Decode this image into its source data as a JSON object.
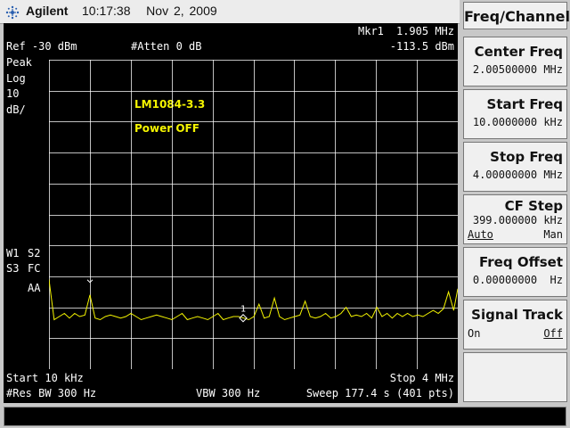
{
  "header": {
    "brand": "Agilent",
    "time": "10:17:38",
    "date": "Nov 2, 2009",
    "icon": "agilent-spark-icon"
  },
  "display": {
    "marker_label": "Mkr1",
    "marker_freq": "1.905 MHz",
    "marker_ampl": "-113.5 dBm",
    "ref_level": "Ref -30 dBm",
    "atten": "#Atten 0 dB",
    "detector": "Peak",
    "scale_type": "Log",
    "scale_value": "10",
    "scale_unit": "dB/",
    "trace_labels": [
      "W1",
      "S2",
      "S3",
      "FC",
      "AA"
    ],
    "annotation_line1": "LM1084-3.3",
    "annotation_line2": "Power OFF",
    "marker_number": "1",
    "start": "Start 10 kHz",
    "stop": "Stop 4 MHz",
    "res_bw": "#Res BW 300 Hz",
    "vbw": "VBW 300 Hz",
    "sweep": "Sweep 177.4 s (401 pts)",
    "colors": {
      "trace": "#f4f400",
      "grid": "#ffffff",
      "background": "#000000",
      "text": "#ffffff"
    }
  },
  "chart_data": {
    "type": "line",
    "xlabel": "",
    "ylabel": "",
    "xlim": [
      10,
      4000
    ],
    "ylim": [
      -130,
      -30
    ],
    "grid": true,
    "series": [
      {
        "x": [
          10,
          60,
          110,
          160,
          210,
          260,
          310,
          360,
          410,
          460,
          510,
          560,
          610,
          660,
          710,
          760,
          810,
          860,
          910,
          960,
          1010,
          1060,
          1110,
          1160,
          1210,
          1260,
          1310,
          1360,
          1410,
          1460,
          1510,
          1560,
          1610,
          1660,
          1710,
          1760,
          1810,
          1860,
          1910,
          1960,
          2010,
          2060,
          2110,
          2160,
          2210,
          2260,
          2310,
          2360,
          2410,
          2460,
          2510,
          2560,
          2610,
          2660,
          2710,
          2760,
          2810,
          2860,
          2910,
          2960,
          3010,
          3060,
          3110,
          3160,
          3210,
          3260,
          3310,
          3360,
          3410,
          3460,
          3510,
          3560,
          3610,
          3660,
          3710,
          3760,
          3810,
          3860,
          3910,
          3960,
          4000
        ],
        "values": [
          -101,
          -114,
          -113,
          -112,
          -113.5,
          -112,
          -113,
          -112.5,
          -106,
          -113.5,
          -114,
          -113,
          -112.5,
          -113,
          -113.5,
          -113,
          -112,
          -113,
          -114,
          -113.5,
          -113,
          -112.5,
          -113,
          -113.5,
          -114,
          -113,
          -112,
          -114,
          -113.5,
          -113,
          -113.5,
          -114,
          -113,
          -112,
          -114,
          -113.5,
          -113,
          -113,
          -113.5,
          -114,
          -113,
          -109,
          -113.5,
          -113,
          -107,
          -113,
          -114,
          -113.5,
          -113,
          -112.5,
          -108,
          -113,
          -113.5,
          -113,
          -112,
          -113.5,
          -113,
          -112,
          -110,
          -113,
          -112.5,
          -113,
          -112,
          -113.5,
          -110,
          -113,
          -112,
          -113.5,
          -112,
          -113,
          -112,
          -113,
          -112.5,
          -113,
          -112,
          -111,
          -112,
          -110.5,
          -105,
          -111,
          -104
        ]
      }
    ],
    "marker": {
      "x": 1905,
      "y": -113.5,
      "label": "1"
    },
    "peak_marker": {
      "x": 410,
      "y": -106
    }
  },
  "softkeys": {
    "menu_title": "Freq/Channel",
    "keys": [
      {
        "label": "Center Freq",
        "value": "2.00500000 MHz"
      },
      {
        "label": "Start Freq",
        "value": "10.0000000 kHz"
      },
      {
        "label": "Stop Freq",
        "value": "4.00000000 MHz"
      },
      {
        "label": "CF Step",
        "value": "399.000000 kHz",
        "opt_left": "Auto",
        "opt_right": "Man"
      },
      {
        "label": "Freq Offset",
        "value": "0.00000000  Hz"
      },
      {
        "label": "Signal Track",
        "opt_left": "On",
        "opt_right": "Off"
      },
      {
        "label": ""
      }
    ]
  }
}
